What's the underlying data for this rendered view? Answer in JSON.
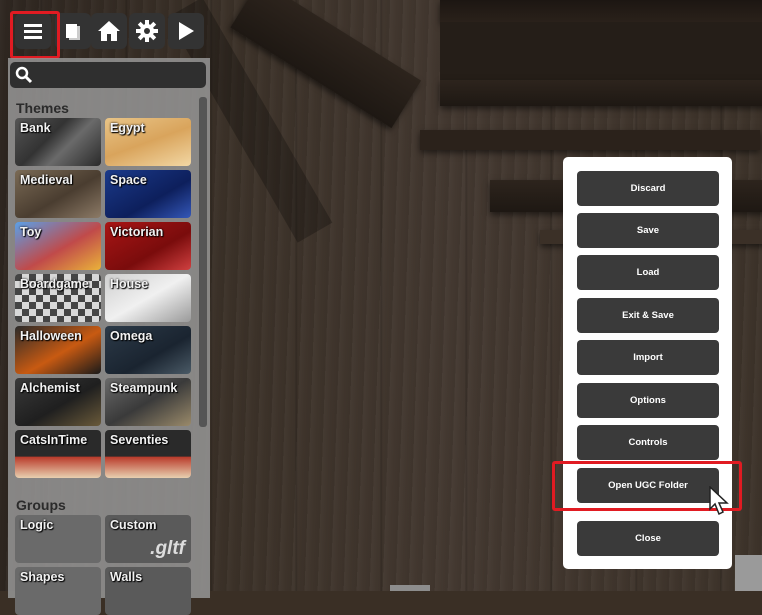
{
  "toolbar": {
    "buttons": [
      {
        "name": "menu",
        "icon": "hamburger-menu-icon"
      },
      {
        "name": "library",
        "icon": "book-icon"
      },
      {
        "name": "home",
        "icon": "home-icon"
      },
      {
        "name": "settings",
        "icon": "gear-icon"
      },
      {
        "name": "play",
        "icon": "play-icon"
      }
    ],
    "highlight_color": "#e11b22"
  },
  "search": {
    "placeholder": "",
    "value": "",
    "icon": "search-icon"
  },
  "themes": {
    "title": "Themes",
    "items": [
      {
        "label": "Bank"
      },
      {
        "label": "Egypt"
      },
      {
        "label": "Medieval"
      },
      {
        "label": "Space"
      },
      {
        "label": "Toy"
      },
      {
        "label": "Victorian"
      },
      {
        "label": "Boardgame"
      },
      {
        "label": "House"
      },
      {
        "label": "Halloween"
      },
      {
        "label": "Omega"
      },
      {
        "label": "Alchemist"
      },
      {
        "label": "Steampunk"
      },
      {
        "label": "CatsInTime"
      },
      {
        "label": "Seventies"
      }
    ]
  },
  "groups": {
    "title": "Groups",
    "items": [
      {
        "label": "Logic"
      },
      {
        "label": "Custom",
        "badge": ".gltf"
      },
      {
        "label": "Shapes"
      },
      {
        "label": "Walls"
      }
    ]
  },
  "menu": {
    "buttons": [
      {
        "label": "Discard"
      },
      {
        "label": "Save"
      },
      {
        "label": "Load"
      },
      {
        "label": "Exit & Save"
      },
      {
        "label": "Import"
      },
      {
        "label": "Options"
      },
      {
        "label": "Controls"
      },
      {
        "label": "Open UGC Folder",
        "highlighted": true
      },
      {
        "label": "Close"
      }
    ],
    "button_color": "#3a3a3a",
    "panel_color": "#ffffff"
  }
}
